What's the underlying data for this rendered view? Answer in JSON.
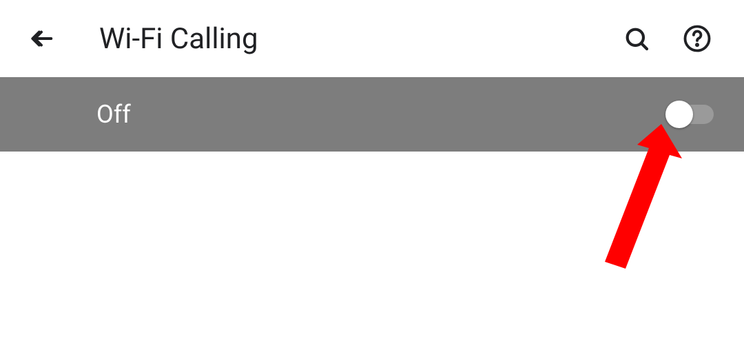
{
  "header": {
    "title": "Wi-Fi Calling"
  },
  "setting": {
    "state_label": "Off",
    "enabled": false
  },
  "colors": {
    "row_bg": "#7d7d7d",
    "arrow": "#ff0000"
  }
}
